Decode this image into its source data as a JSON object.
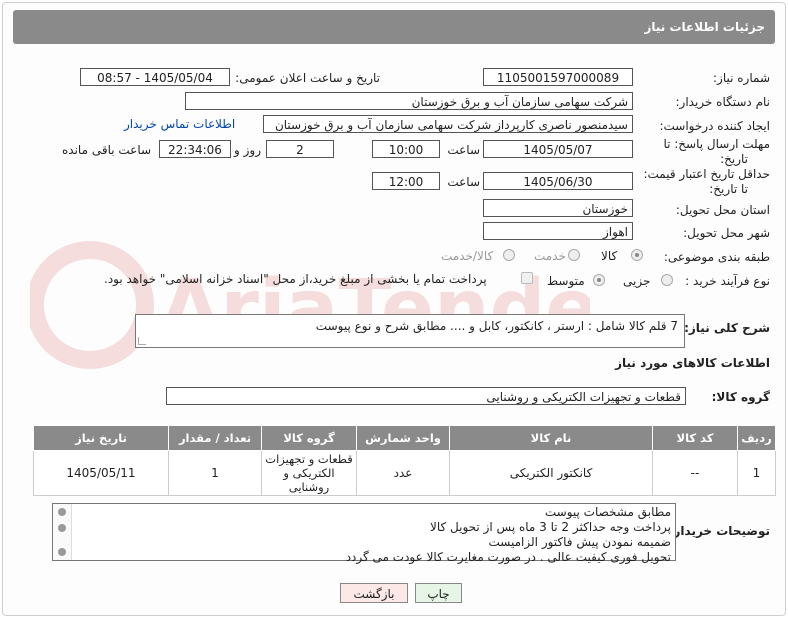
{
  "header": {
    "title": "جزئیات اطلاعات نیاز"
  },
  "fields": {
    "need_number_label": "شماره نیاز:",
    "need_number": "1105001597000089",
    "announce_label": "تاریخ و ساعت اعلان عمومی:",
    "announce_value": "1405/05/04 - 08:57",
    "buyer_org_label": "نام دستگاه خریدار:",
    "buyer_org": "شرکت سهامی سازمان آب و برق خوزستان",
    "creator_label": "ایجاد کننده درخواست:",
    "creator": "سیدمنصور ناصری کارپرداز شرکت سهامی سازمان آب و برق خوزستان",
    "buyer_contact_link": "اطلاعات تماس خریدار",
    "deadline_label_1": "مهلت ارسال پاسخ: تا",
    "deadline_label_2": "تاریخ:",
    "deadline_date": "1405/05/07",
    "time_label": "ساعت",
    "deadline_time": "10:00",
    "days_value": "2",
    "days_label": "روز و",
    "remaining_time": "22:34:06",
    "remaining_label": "ساعت باقی مانده",
    "validity_label_1": "حداقل تاریخ اعتبار قیمت:",
    "validity_label_2": "تا تاریخ:",
    "validity_date": "1405/06/30",
    "validity_time": "12:00",
    "province_label": "استان محل تحویل:",
    "province": "خوزستان",
    "city_label": "شهر محل تحویل:",
    "city": "اهواز",
    "category_label": "طبقه بندی موضوعی:",
    "category_options": [
      "کالا",
      "خدمت",
      "کالا/خدمت"
    ],
    "category_selected": "کالا",
    "process_label": "نوع فرآیند خرید :",
    "process_options": [
      "جزیی",
      "متوسط"
    ],
    "process_selected": "متوسط",
    "payment_note": "پرداخت تمام یا بخشی از مبلغ خرید،از محل \"اسناد خزانه اسلامی\" خواهد بود."
  },
  "description": {
    "label": "شرح کلی نیاز:",
    "text": "7 قلم کالا شامل : ارستر ، کانکتور، کابل و .... مطابق شرح و نوع پیوست"
  },
  "goods_section": {
    "title": "اطلاعات کالاهای مورد نیاز",
    "group_label": "گروه کالا:",
    "group_value": "قطعات و تجهیزات الکتریکی و روشنایی"
  },
  "table": {
    "headers": [
      "ردیف",
      "کد کالا",
      "نام کالا",
      "واحد شمارش",
      "گروه کالا",
      "تعداد / مقدار",
      "تاریخ نیاز"
    ],
    "rows": [
      [
        "1",
        "--",
        "کانکتور الکتریکی",
        "عدد",
        "قطعات و تجهیزات الکتریکی و روشنایی",
        "1",
        "1405/05/11"
      ]
    ]
  },
  "notes": {
    "label": "توضیحات خریدار:",
    "lines": [
      "مطابق مشخصات پیوست",
      "پرداخت وجه حداکثر 2 تا 3 ماه پس از تحویل کالا",
      "ضمیمه نمودن پیش فاکتور الزامیست",
      "تحویل فوری کیفیت عالی . در صورت مغایرت کالا عودت می گردد"
    ]
  },
  "buttons": {
    "print": "چاپ",
    "back": "بازگشت"
  },
  "watermark": {
    "text": "AriaTender.neT"
  },
  "colors": {
    "header_bg": "#8a8a8a",
    "link": "#0645ad",
    "back_btn_bg": "#fde8e8",
    "print_btn_bg": "#e6f5e6"
  }
}
